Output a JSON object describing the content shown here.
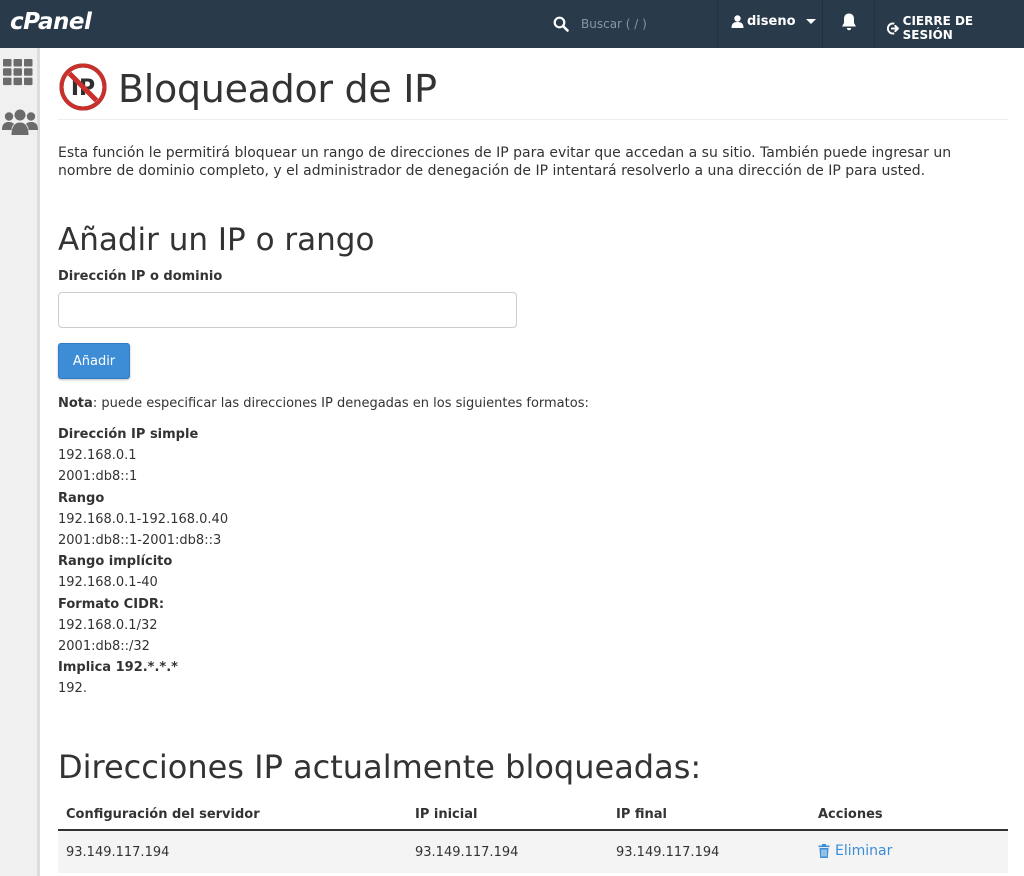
{
  "topbar": {
    "logo": "cPanel",
    "search_placeholder": "Buscar ( / )",
    "user": "diseno",
    "logout": "CIERRE DE SESIÓN"
  },
  "sidebar": {
    "icons": [
      "grid-icon",
      "users-icon"
    ]
  },
  "page": {
    "title": "Bloqueador de IP",
    "header_icon_text": "IP",
    "description": "Esta función le permitirá bloquear un rango de direcciones de IP para evitar que accedan a su sitio. También puede ingresar un nombre de dominio completo, y el administrador de denegación de IP intentará resolverlo a una dirección de IP para usted."
  },
  "add_section": {
    "title": "Añadir un IP o rango",
    "field_label": "Dirección IP o dominio",
    "field_value": "",
    "button_label": "Añadir"
  },
  "note": {
    "label": "Nota",
    "text": ": puede especificar las direcciones IP denegadas en los siguientes formatos:"
  },
  "formats": [
    {
      "heading": "Dirección IP simple",
      "examples": [
        "192.168.0.1",
        "2001:db8::1"
      ]
    },
    {
      "heading": "Rango",
      "examples": [
        "192.168.0.1-192.168.0.40",
        "2001:db8::1-2001:db8::3"
      ]
    },
    {
      "heading": "Rango implícito",
      "examples": [
        "192.168.0.1-40"
      ]
    },
    {
      "heading": "Formato CIDR:",
      "examples": [
        "192.168.0.1/32",
        "2001:db8::/32"
      ]
    },
    {
      "heading": "Implica 192.*.*.*",
      "examples": [
        "192."
      ]
    }
  ],
  "blocked": {
    "title": "Direcciones IP actualmente bloqueadas:",
    "columns": [
      "Configuración del servidor",
      "IP inicial",
      "IP final",
      "Acciones"
    ],
    "rows": [
      {
        "server": "93.149.117.194",
        "start": "93.149.117.194",
        "end": "93.149.117.194",
        "action": "Eliminar"
      }
    ]
  },
  "colors": {
    "topbar": "#293a4a",
    "accent": "#3c8dd6",
    "sidebar": "#f0f0f0"
  }
}
